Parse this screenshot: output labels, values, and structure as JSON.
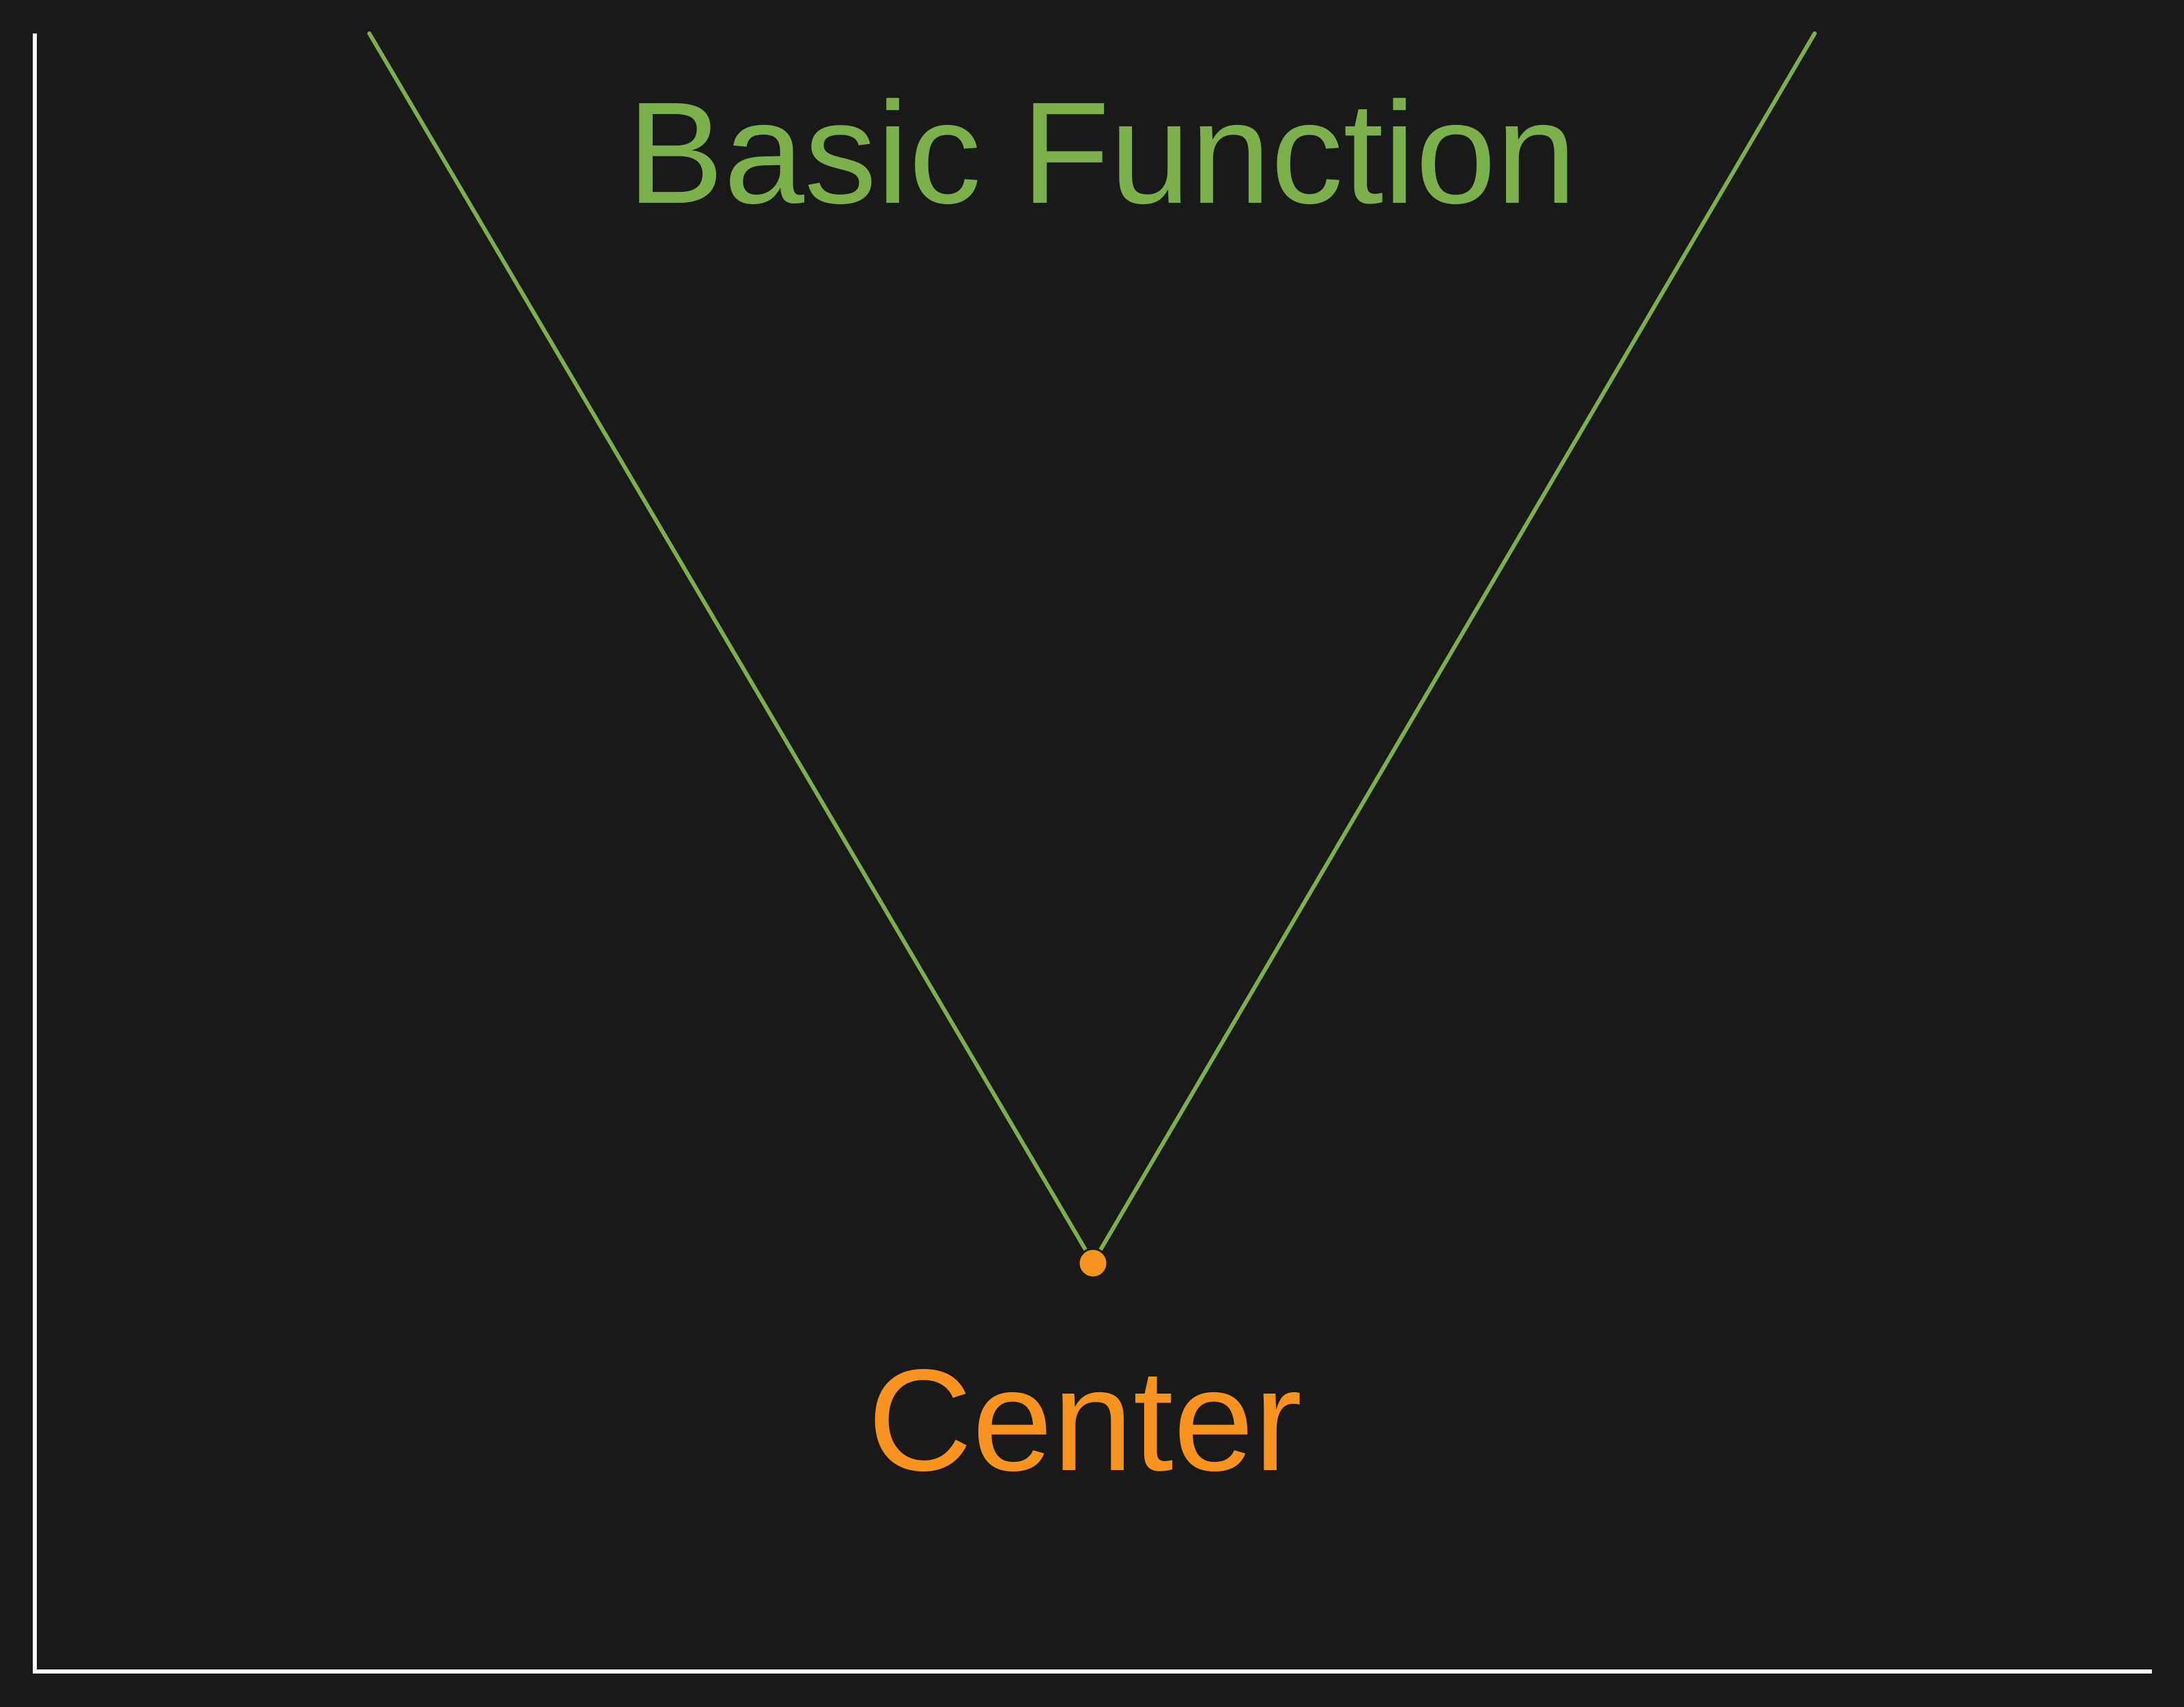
{
  "diagram": {
    "title": "Basic Function",
    "point_label": "Center",
    "colors": {
      "background": "#191919",
      "axes": "#ffffff",
      "function": "#7cb04a",
      "center": "#f7931e"
    }
  }
}
